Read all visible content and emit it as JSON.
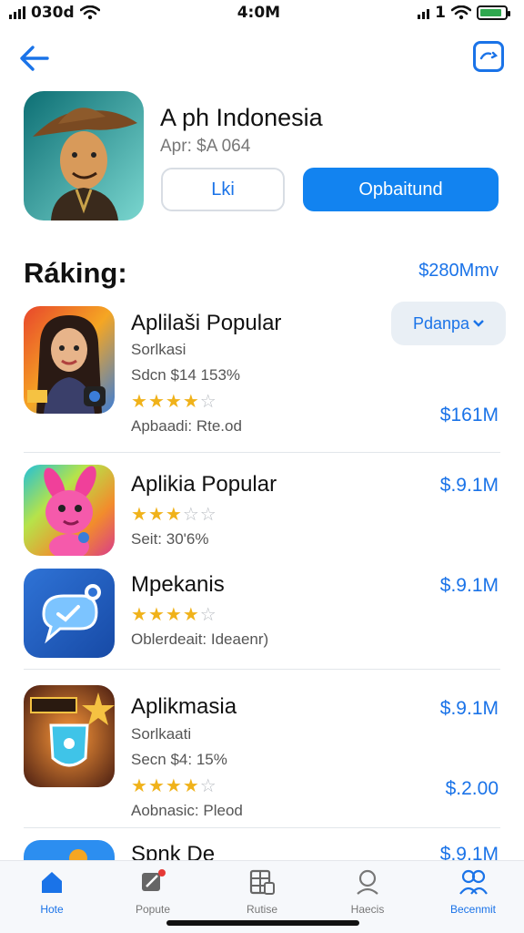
{
  "status_bar": {
    "carrier": "030d",
    "time": "4:0M",
    "signal_label": "1",
    "battery_level": 0.9,
    "icons": [
      "wifi-icon",
      "signal-icon",
      "battery-icon"
    ]
  },
  "nav": {
    "back_icon": "arrow-left-icon",
    "share_icon": "share-square-icon"
  },
  "hero": {
    "title": "A ph Indonesia",
    "subtitle": "Apr: $A 064",
    "like_label": "Lki",
    "primary_label": "Opbaitund"
  },
  "section": {
    "title": "Ráking:",
    "amount": "$280Mmv"
  },
  "apps": [
    {
      "name": "Aplilaši Popular",
      "meta1": "Sorlkasi",
      "meta2": "Sdcn $14 153%",
      "rating": 4,
      "meta3": "Apbaadi: Rte.od",
      "price": "$161M",
      "chip_label": "Pdanpa",
      "icon": "girl-character-icon"
    },
    {
      "name": "Aplikia Popular",
      "rating": 3,
      "meta1": "Seit: 30'6%",
      "price": "$.9.1M",
      "icon": "pink-bunny-icon"
    },
    {
      "name": "Mpekanis",
      "rating": 4,
      "meta1": "Oblerdeait: Ideaenr)",
      "price": "$.9.1M",
      "icon": "chat-bubble-icon"
    },
    {
      "name": "Aplikmasia",
      "meta1": "Sorlkaati",
      "meta2": "Secn $4: 15%",
      "rating": 4,
      "meta3": "Aobnasic: Pleod",
      "price": "$.9.1M",
      "price2": "$.2.00",
      "icon": "shield-star-icon"
    },
    {
      "name": "Spnk De",
      "price": "$.9.1M",
      "icon": "blue-app-icon"
    }
  ],
  "tabs": [
    {
      "label": "Hote",
      "icon": "home-icon",
      "active": true
    },
    {
      "label": "Popute",
      "icon": "edit-icon",
      "active": false
    },
    {
      "label": "Rutise",
      "icon": "grid-icon",
      "active": false
    },
    {
      "label": "Haecis",
      "icon": "search-person-icon",
      "active": false
    },
    {
      "label": "Becenmit",
      "icon": "people-icon",
      "active": false
    }
  ],
  "colors": {
    "accent": "#1a73e8",
    "primary_button": "#1283f0",
    "star": "#f0b21a"
  }
}
